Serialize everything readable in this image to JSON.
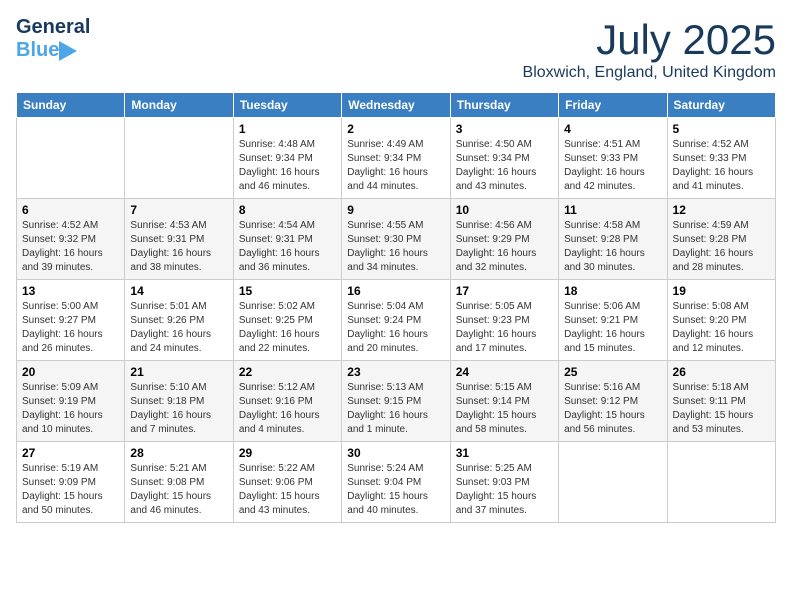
{
  "header": {
    "logo_line1": "General",
    "logo_line2": "Blue",
    "month_title": "July 2025",
    "subtitle": "Bloxwich, England, United Kingdom"
  },
  "days_of_week": [
    "Sunday",
    "Monday",
    "Tuesday",
    "Wednesday",
    "Thursday",
    "Friday",
    "Saturday"
  ],
  "weeks": [
    [
      {
        "num": "",
        "info": ""
      },
      {
        "num": "",
        "info": ""
      },
      {
        "num": "1",
        "info": "Sunrise: 4:48 AM\nSunset: 9:34 PM\nDaylight: 16 hours and 46 minutes."
      },
      {
        "num": "2",
        "info": "Sunrise: 4:49 AM\nSunset: 9:34 PM\nDaylight: 16 hours and 44 minutes."
      },
      {
        "num": "3",
        "info": "Sunrise: 4:50 AM\nSunset: 9:34 PM\nDaylight: 16 hours and 43 minutes."
      },
      {
        "num": "4",
        "info": "Sunrise: 4:51 AM\nSunset: 9:33 PM\nDaylight: 16 hours and 42 minutes."
      },
      {
        "num": "5",
        "info": "Sunrise: 4:52 AM\nSunset: 9:33 PM\nDaylight: 16 hours and 41 minutes."
      }
    ],
    [
      {
        "num": "6",
        "info": "Sunrise: 4:52 AM\nSunset: 9:32 PM\nDaylight: 16 hours and 39 minutes."
      },
      {
        "num": "7",
        "info": "Sunrise: 4:53 AM\nSunset: 9:31 PM\nDaylight: 16 hours and 38 minutes."
      },
      {
        "num": "8",
        "info": "Sunrise: 4:54 AM\nSunset: 9:31 PM\nDaylight: 16 hours and 36 minutes."
      },
      {
        "num": "9",
        "info": "Sunrise: 4:55 AM\nSunset: 9:30 PM\nDaylight: 16 hours and 34 minutes."
      },
      {
        "num": "10",
        "info": "Sunrise: 4:56 AM\nSunset: 9:29 PM\nDaylight: 16 hours and 32 minutes."
      },
      {
        "num": "11",
        "info": "Sunrise: 4:58 AM\nSunset: 9:28 PM\nDaylight: 16 hours and 30 minutes."
      },
      {
        "num": "12",
        "info": "Sunrise: 4:59 AM\nSunset: 9:28 PM\nDaylight: 16 hours and 28 minutes."
      }
    ],
    [
      {
        "num": "13",
        "info": "Sunrise: 5:00 AM\nSunset: 9:27 PM\nDaylight: 16 hours and 26 minutes."
      },
      {
        "num": "14",
        "info": "Sunrise: 5:01 AM\nSunset: 9:26 PM\nDaylight: 16 hours and 24 minutes."
      },
      {
        "num": "15",
        "info": "Sunrise: 5:02 AM\nSunset: 9:25 PM\nDaylight: 16 hours and 22 minutes."
      },
      {
        "num": "16",
        "info": "Sunrise: 5:04 AM\nSunset: 9:24 PM\nDaylight: 16 hours and 20 minutes."
      },
      {
        "num": "17",
        "info": "Sunrise: 5:05 AM\nSunset: 9:23 PM\nDaylight: 16 hours and 17 minutes."
      },
      {
        "num": "18",
        "info": "Sunrise: 5:06 AM\nSunset: 9:21 PM\nDaylight: 16 hours and 15 minutes."
      },
      {
        "num": "19",
        "info": "Sunrise: 5:08 AM\nSunset: 9:20 PM\nDaylight: 16 hours and 12 minutes."
      }
    ],
    [
      {
        "num": "20",
        "info": "Sunrise: 5:09 AM\nSunset: 9:19 PM\nDaylight: 16 hours and 10 minutes."
      },
      {
        "num": "21",
        "info": "Sunrise: 5:10 AM\nSunset: 9:18 PM\nDaylight: 16 hours and 7 minutes."
      },
      {
        "num": "22",
        "info": "Sunrise: 5:12 AM\nSunset: 9:16 PM\nDaylight: 16 hours and 4 minutes."
      },
      {
        "num": "23",
        "info": "Sunrise: 5:13 AM\nSunset: 9:15 PM\nDaylight: 16 hours and 1 minute."
      },
      {
        "num": "24",
        "info": "Sunrise: 5:15 AM\nSunset: 9:14 PM\nDaylight: 15 hours and 58 minutes."
      },
      {
        "num": "25",
        "info": "Sunrise: 5:16 AM\nSunset: 9:12 PM\nDaylight: 15 hours and 56 minutes."
      },
      {
        "num": "26",
        "info": "Sunrise: 5:18 AM\nSunset: 9:11 PM\nDaylight: 15 hours and 53 minutes."
      }
    ],
    [
      {
        "num": "27",
        "info": "Sunrise: 5:19 AM\nSunset: 9:09 PM\nDaylight: 15 hours and 50 minutes."
      },
      {
        "num": "28",
        "info": "Sunrise: 5:21 AM\nSunset: 9:08 PM\nDaylight: 15 hours and 46 minutes."
      },
      {
        "num": "29",
        "info": "Sunrise: 5:22 AM\nSunset: 9:06 PM\nDaylight: 15 hours and 43 minutes."
      },
      {
        "num": "30",
        "info": "Sunrise: 5:24 AM\nSunset: 9:04 PM\nDaylight: 15 hours and 40 minutes."
      },
      {
        "num": "31",
        "info": "Sunrise: 5:25 AM\nSunset: 9:03 PM\nDaylight: 15 hours and 37 minutes."
      },
      {
        "num": "",
        "info": ""
      },
      {
        "num": "",
        "info": ""
      }
    ]
  ]
}
